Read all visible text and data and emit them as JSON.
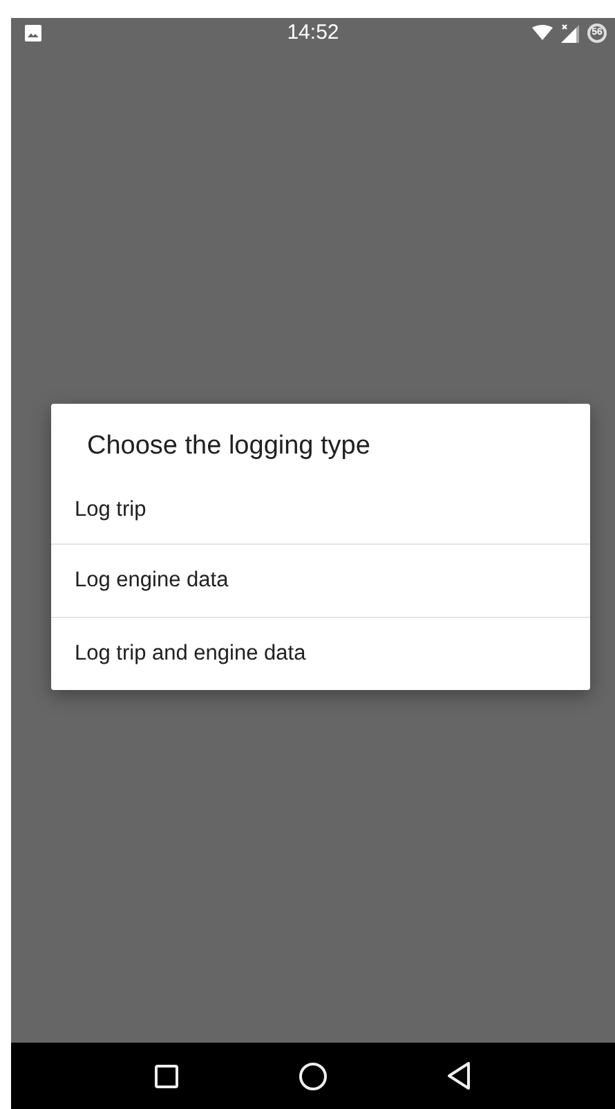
{
  "status_bar": {
    "time": "14:52",
    "battery_level_text": "56"
  },
  "dialog": {
    "title": "Choose the logging type",
    "items": [
      {
        "label": "Log trip"
      },
      {
        "label": "Log engine data"
      },
      {
        "label": "Log trip and engine data"
      }
    ]
  }
}
